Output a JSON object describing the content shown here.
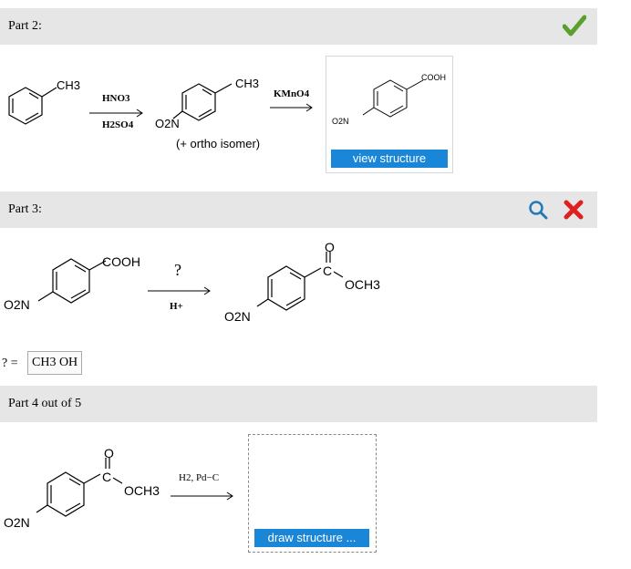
{
  "part2": {
    "title": "Part 2:",
    "status_icon": "checkmark-icon",
    "reactant_group": "CH3",
    "reagent_top": "HNO3",
    "reagent_bottom": "H2SO4",
    "product_group_top": "CH3",
    "product_group_nitro": "O2N",
    "isomer_note": "(+ ortho isomer)",
    "reagent2": "KMnO4",
    "answer_group_top": "COOH",
    "answer_group_nitro": "O2N",
    "view_button": "view structure"
  },
  "part3": {
    "title": "Part 3:",
    "icons": [
      "magnifier-icon",
      "x-mark-icon"
    ],
    "reactant_group": "COOH",
    "reactant_nitro": "O2N",
    "unknown": "?",
    "catalyst": "H+",
    "product_carbonyl_o": "O",
    "product_c": "C",
    "product_och3": "OCH3",
    "product_nitro": "O2N",
    "answer_prefix": "? =",
    "answer_value": "CH3 OH"
  },
  "part4": {
    "title": "Part 4 out of 5",
    "reactant_carbonyl_o": "O",
    "reactant_c": "C",
    "reactant_och3": "OCH3",
    "reactant_nitro": "O2N",
    "reagent": "H2, Pd−C",
    "draw_button": "draw structure ..."
  },
  "colors": {
    "accent_blue": "#1a86d8",
    "check_green": "#5aa02c",
    "x_red": "#e02020",
    "bar_gray": "#e6e6e6"
  }
}
